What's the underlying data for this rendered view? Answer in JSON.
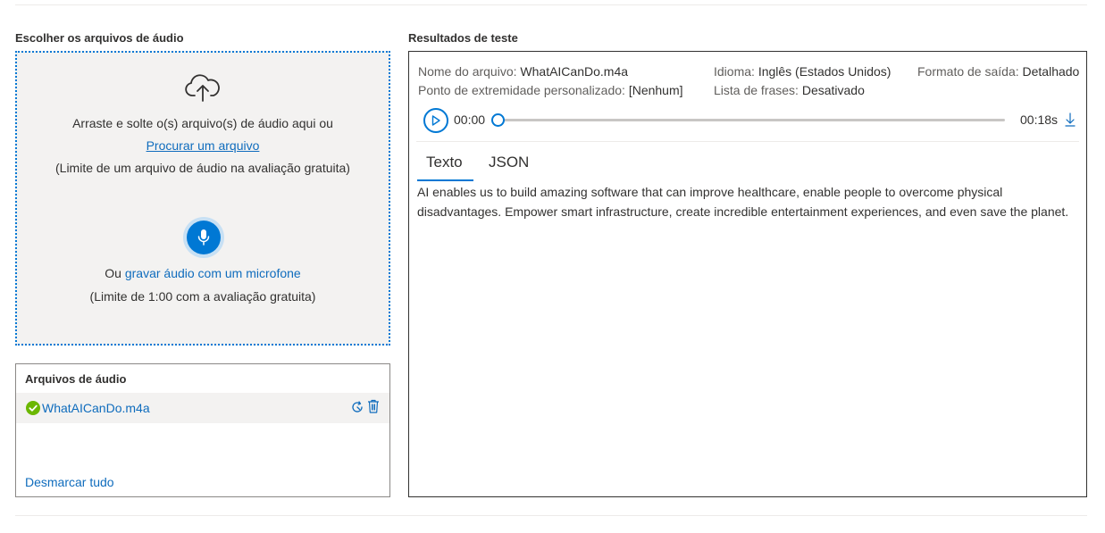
{
  "left": {
    "section_title": "Escolher os arquivos de áudio",
    "dropzone": {
      "drag_text": "Arraste e solte o(s) arquivo(s) de áudio aqui ou",
      "browse_link": "Procurar um arquivo",
      "limit_text": "(Limite de um arquivo de áudio na avaliação gratuita)",
      "or_prefix": "Ou",
      "record_link": "gravar áudio com um microfone",
      "record_limit": "(Limite de 1:00 com a avaliação gratuita)"
    },
    "files": {
      "title": "Arquivos de áudio",
      "items": [
        {
          "name": "WhatAICanDo.m4a",
          "status": "success"
        }
      ],
      "deselect_all": "Desmarcar tudo"
    }
  },
  "results": {
    "section_title": "Resultados de teste",
    "meta": {
      "file_label": "Nome do arquivo:",
      "file_value": "WhatAICanDo.m4a",
      "language_label": "Idioma:",
      "language_value": "Inglês (Estados Unidos)",
      "format_label": "Formato de saída:",
      "format_value": "Detalhado",
      "endpoint_label": "Ponto de extremidade personalizado:",
      "endpoint_value": "[Nenhum]",
      "phrases_label": "Lista de frases:",
      "phrases_value": "Desativado"
    },
    "player": {
      "current_time": "00:00",
      "duration": "00:18s",
      "progress": 0
    },
    "tabs": [
      {
        "label": "Texto",
        "active": true
      },
      {
        "label": "JSON",
        "active": false
      }
    ],
    "text": "AI enables us to build amazing software that can improve healthcare, enable people to overcome physical disadvantages. Empower smart infrastructure, create incredible entertainment experiences, and even save the planet."
  },
  "colors": {
    "accent": "#0078d4",
    "link": "#0f6cbd",
    "success": "#6bb700",
    "panel_bg": "#f3f2f1"
  }
}
